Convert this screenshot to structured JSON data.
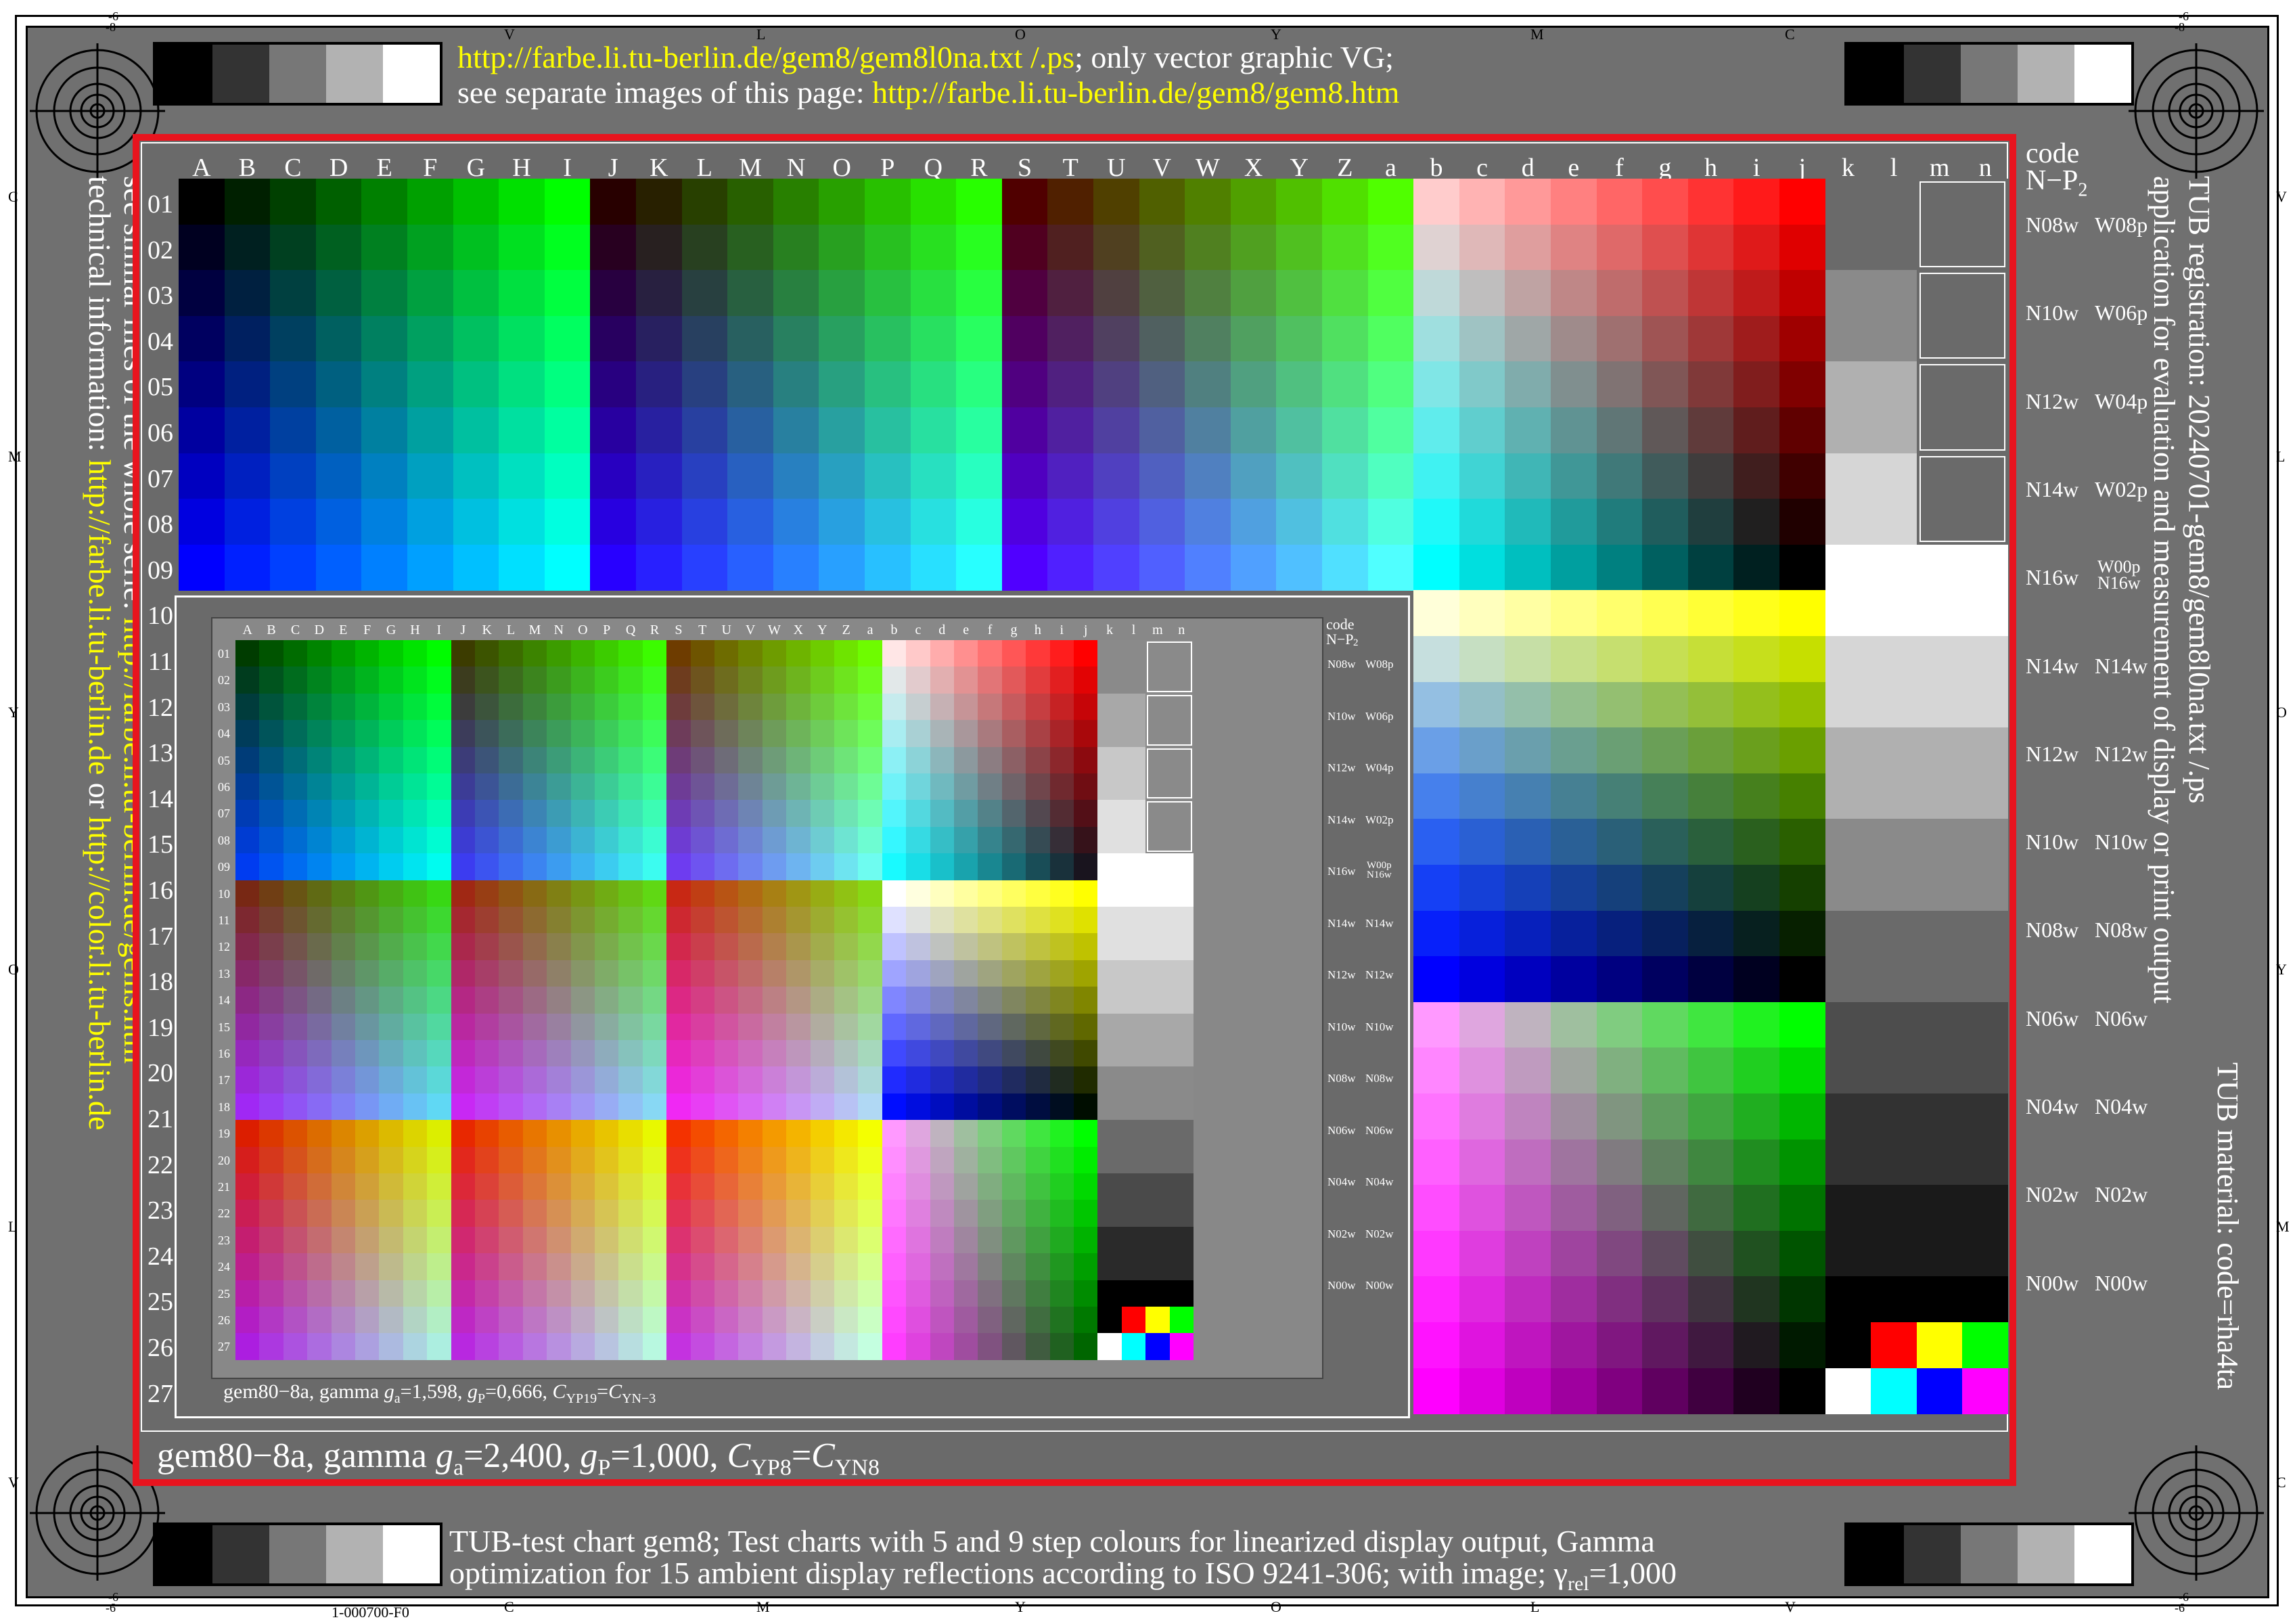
{
  "header": {
    "line1_url": "http://farbe.li.tu-berlin.de/gem8/gem8l0na.txt /.ps",
    "line1_rest": "; only vector graphic VG;",
    "line2_prefix": "see separate images of this page: ",
    "line2_url": "http://farbe.li.tu-berlin.de/gem8/gem8.htm"
  },
  "footer": {
    "line1": "TUB-test chart gem8; Test charts with 5 and 9 step colours for linearized display output, Gamma",
    "line2": "optimization for 15 ambient display reflections according to ISO 9241-306; with image; γ",
    "line2_sub": "rel",
    "line2_tail": "=1,000",
    "page_code": "1-000700-F0"
  },
  "left_side": {
    "line1_prefix": "see similar files of the whole serie: ",
    "line1_url": "http://farbe.li.tu-berlin.de/gems.htm",
    "line2_prefix": "technical information: ",
    "line2_url": "http://farbe.li.tu-berlin.de",
    "line2_mid": " or ",
    "line2_url2": "http://color.li.tu-berlin.de"
  },
  "right_side": {
    "line1": "TUB registration: 20240701-gem8/gem8l0na.txt /.ps",
    "line2": "application for evaluation and measurement of display or print output",
    "line3": "TUB material: code=rha4ta"
  },
  "outer_edge_letters": {
    "top": [
      "V",
      "L",
      "O",
      "Y",
      "M",
      "C"
    ],
    "bottom": [
      "C",
      "M",
      "Y",
      "O",
      "L",
      "V"
    ],
    "left": [
      "C",
      "M",
      "Y",
      "O",
      "L",
      "V"
    ],
    "right": [
      "V",
      "L",
      "O",
      "Y",
      "M",
      "C"
    ],
    "corner": "-6",
    "corner_top_left": "-8",
    "corner_top_right": "-8"
  },
  "main_chart": {
    "column_letters": [
      "A",
      "B",
      "C",
      "D",
      "E",
      "F",
      "G",
      "H",
      "I",
      "J",
      "K",
      "L",
      "M",
      "N",
      "O",
      "P",
      "Q",
      "R",
      "S",
      "T",
      "U",
      "V",
      "W",
      "X",
      "Y",
      "Z",
      "a",
      "b",
      "c",
      "d",
      "e",
      "f",
      "g",
      "h",
      "i",
      "j",
      "k",
      "l",
      "m",
      "n"
    ],
    "row_numbers": [
      "01",
      "02",
      "03",
      "04",
      "05",
      "06",
      "07",
      "08",
      "09",
      "10",
      "11",
      "12",
      "13",
      "14",
      "15",
      "16",
      "17",
      "18",
      "19",
      "20",
      "21",
      "22",
      "23",
      "24",
      "25",
      "26",
      "27"
    ],
    "code_header": "code",
    "code_sub": "N−P",
    "code_sub2": "2",
    "gray_codes": [
      [
        "N08w",
        "W08p"
      ],
      [
        "N10w",
        "W06p"
      ],
      [
        "N12w",
        "W04p"
      ],
      [
        "N14w",
        "W02p"
      ],
      [
        "N16w",
        "W00p",
        "N16w"
      ],
      [
        "N14w",
        "N14w"
      ],
      [
        "N12w",
        "N12w"
      ],
      [
        "N10w",
        "N10w"
      ],
      [
        "N08w",
        "N08w"
      ],
      [
        "N06w",
        "N06w"
      ],
      [
        "N04w",
        "N04w"
      ],
      [
        "N02w",
        "N02w"
      ],
      [
        "N00w",
        "N00w"
      ]
    ],
    "caption_prefix": "gem80−8a, gamma ",
    "caption_g": "g",
    "caption_a": "a",
    "caption_ga_val": "=2,400, ",
    "caption_p": "P",
    "caption_gp_val": "=1,000, ",
    "caption_c": "C",
    "caption_yp": "YP8",
    "caption_eq": "=",
    "caption_yn": "YN8"
  },
  "inset_chart": {
    "row_numbers": [
      "01",
      "02",
      "03",
      "04",
      "05",
      "06",
      "07",
      "08",
      "09",
      "10",
      "11",
      "12",
      "13",
      "14",
      "15",
      "16",
      "17",
      "18",
      "19",
      "20",
      "21",
      "22",
      "23",
      "24",
      "25",
      "26",
      "27"
    ],
    "caption_prefix": "gem80−8a, gamma ",
    "caption_g": "g",
    "caption_a": "a",
    "caption_ga_val": "=1,598, ",
    "caption_p": "P",
    "caption_gp_val": "=0,666, ",
    "caption_c": "C",
    "caption_yp": "YP19",
    "caption_eq": "=",
    "caption_yn": "YN−3"
  },
  "colors": {
    "frame_gray": "#707070",
    "red_border": "#e8141e",
    "yellow_text": "#ffff00"
  }
}
